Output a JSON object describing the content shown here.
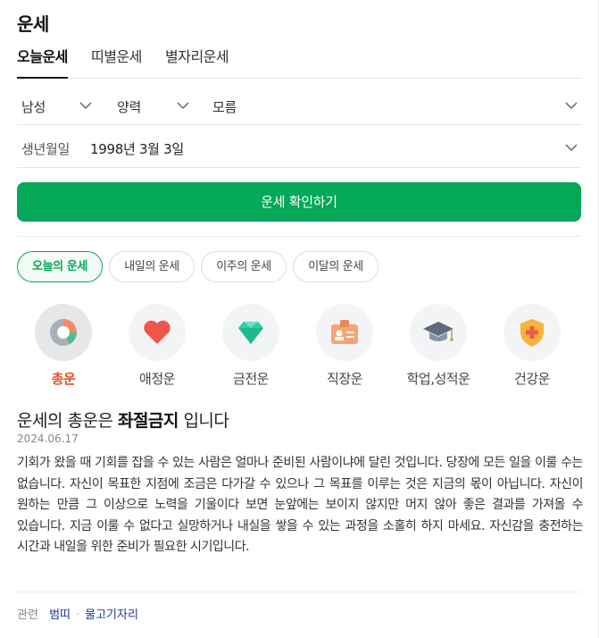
{
  "header": {
    "title": "운세"
  },
  "tabs": [
    {
      "label": "오늘운세",
      "active": true
    },
    {
      "label": "띠별운세",
      "active": false
    },
    {
      "label": "별자리운세",
      "active": false
    }
  ],
  "form": {
    "gender": "남성",
    "calendar": "양력",
    "birth_time": "모름",
    "birth_label": "생년월일",
    "birth_value": "1998년 3월 3일",
    "submit_label": "운세 확인하기"
  },
  "period_pills": [
    {
      "label": "오늘의 운세",
      "active": true
    },
    {
      "label": "내일의 운세",
      "active": false
    },
    {
      "label": "이주의 운세",
      "active": false
    },
    {
      "label": "이달의 운세",
      "active": false
    }
  ],
  "categories": [
    {
      "label": "총운",
      "icon": "pie-chart-icon",
      "active": true
    },
    {
      "label": "애정운",
      "icon": "heart-icon",
      "active": false
    },
    {
      "label": "금전운",
      "icon": "gem-icon",
      "active": false
    },
    {
      "label": "직장운",
      "icon": "id-badge-icon",
      "active": false
    },
    {
      "label": "학업,성적운",
      "icon": "graduation-cap-icon",
      "active": false
    },
    {
      "label": "건강운",
      "icon": "health-shield-icon",
      "active": false
    }
  ],
  "result": {
    "headline_prefix": "운세의 총운은",
    "headline_bold": "좌절금지",
    "headline_suffix": "입니다",
    "date": "2024.06.17",
    "body": "기회가 왔을 때 기회를 잡을 수 있는 사람은 얼마나 준비된 사람이냐에 달린 것입니다. 당장에 모든 일을 이룰 수는 없습니다. 자신이 목표한 지점에 조금은 다가갈 수 있으나 그 목표를 이루는 것은 지금의 몫이 아닙니다. 자신이 원하는 만큼 그 이상으로 노력을 기울이다 보면 눈앞에는 보이지 않지만 머지 않아 좋은 결과를 가져올 수 있습니다. 지금 이룰 수 없다고 실망하거나 내실을 쌓을 수 있는 과정을 소홀히 하지 마세요. 자신감을 충전하는 시간과 내일을 위한 준비가 필요한 시기입니다."
  },
  "related": {
    "label": "관련",
    "links": [
      "범띠",
      "물고기자리"
    ]
  },
  "colors": {
    "accent": "#03a859",
    "active_category": "#e3522b",
    "link": "#1a3a99"
  }
}
